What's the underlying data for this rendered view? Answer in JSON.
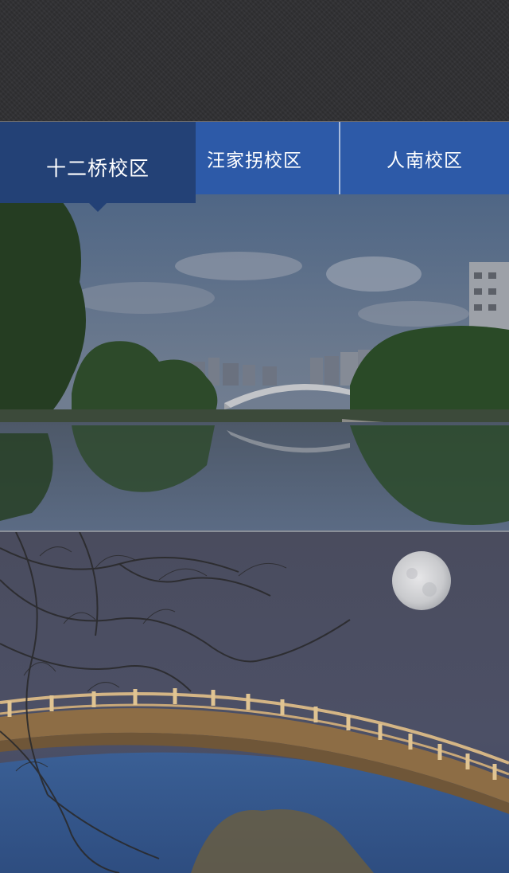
{
  "tabs": [
    {
      "label": "十二桥校区",
      "active": true
    },
    {
      "label": "汪家拐校区",
      "active": false
    },
    {
      "label": "人南校区",
      "active": false
    }
  ],
  "colors": {
    "tab_bar": "#2d5aa8",
    "tab_active": "#234176",
    "top_bar": "#2f2f32"
  },
  "images": [
    {
      "name": "campus-lake-bridge-photo"
    },
    {
      "name": "moon-arch-bridge-night-photo"
    }
  ]
}
